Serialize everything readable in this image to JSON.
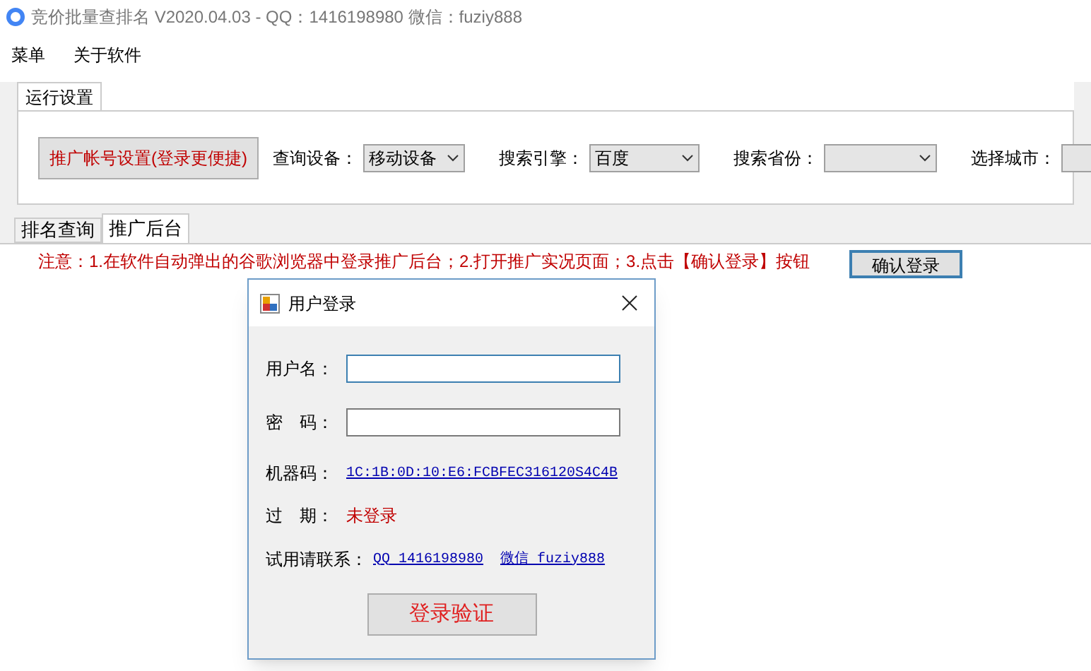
{
  "window": {
    "title": "竞价批量查排名 V2020.04.03 - QQ：1416198980  微信：fuziy888"
  },
  "menu": [
    "菜单",
    "关于软件"
  ],
  "top_tabs": [
    {
      "label": "运行设置",
      "selected": true
    }
  ],
  "settings": {
    "account_button": "推广帐号设置(登录更便捷)",
    "fields": [
      {
        "label": "查询设备：",
        "value": "移动设备"
      },
      {
        "label": "搜索引擎：",
        "value": "百度"
      },
      {
        "label": "搜索省份："
      },
      {
        "label": "选择城市："
      }
    ]
  },
  "tabs": [
    {
      "label": "排名查询",
      "selected": false
    },
    {
      "label": "推广后台",
      "selected": true
    }
  ],
  "notice": "注意：1.在软件自动弹出的谷歌浏览器中登录推广后台；2.打开推广实况页面；3.点击【确认登录】按钮",
  "confirm_button": "确认登录",
  "dialog": {
    "title": "用户登录",
    "username_label": "用户名：",
    "password_label": "密　码：",
    "machine_label": "机器码：",
    "machine_code": "1C:1B:0D:10:E6:FCBFEC316120S4C4B",
    "expiry_label": "过　期：",
    "expiry_value": "未登录",
    "contact_label": "试用请联系：",
    "contact_links": [
      "QQ 1416198980",
      "微信 fuziy888"
    ],
    "submit": "登录验证"
  }
}
